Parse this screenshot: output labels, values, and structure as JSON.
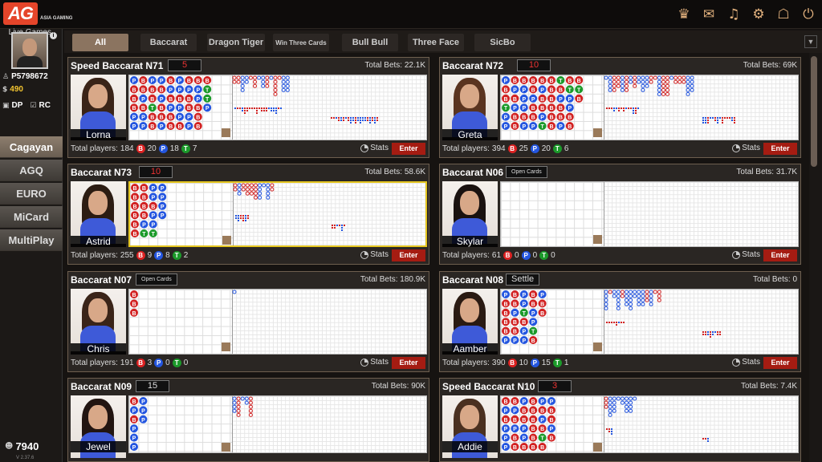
{
  "app": {
    "logo": "AG",
    "logo_sub": "ASIA GAMING"
  },
  "top_icons": [
    "vip-icon",
    "chat-icon",
    "music-icon",
    "settings-icon",
    "message-icon",
    "power-icon"
  ],
  "user": {
    "id": "P5798672",
    "credit": "490",
    "dp": "DP",
    "rc": "RC",
    "live_games": "Live Games"
  },
  "menu": [
    {
      "label": "Cagayan",
      "active": true
    },
    {
      "label": "AGQ"
    },
    {
      "label": "EURO"
    },
    {
      "label": "MiCard"
    },
    {
      "label": "MultiPlay"
    }
  ],
  "online_count": "7940",
  "version": "V 2.37.6",
  "tabs": [
    {
      "label": "All",
      "active": true
    },
    {
      "label": "Baccarat"
    },
    {
      "label": "Dragon Tiger"
    },
    {
      "label": "Win Three Cards"
    },
    {
      "label": "Bull Bull"
    },
    {
      "label": "Three Face"
    },
    {
      "label": "SicBo"
    }
  ],
  "labels": {
    "total_bets": "Total Bets:",
    "total_players": "Total players:",
    "stats": "Stats",
    "enter": "Enter"
  },
  "tables": [
    {
      "name": "Speed Baccarat N71",
      "countdown": "5",
      "total_bets": "22.1K",
      "dealer": "Lorna",
      "players": "184",
      "b": "20",
      "p": "18",
      "t": "7"
    },
    {
      "name": "Baccarat N72",
      "countdown": "10",
      "total_bets": "69K",
      "dealer": "Greta",
      "players": "394",
      "b": "25",
      "p": "20",
      "t": "6"
    },
    {
      "name": "Baccarat N73",
      "countdown": "10",
      "total_bets": "58.6K",
      "dealer": "Astrid",
      "players": "255",
      "b": "9",
      "p": "8",
      "t": "2"
    },
    {
      "name": "Baccarat N06",
      "status": "Open Cards",
      "total_bets": "31.7K",
      "dealer": "Skylar",
      "players": "61",
      "b": "0",
      "p": "0",
      "t": "0"
    },
    {
      "name": "Baccarat N07",
      "status": "Open Cards",
      "total_bets": "180.9K",
      "dealer": "Chris",
      "players": "191",
      "b": "3",
      "p": "0",
      "t": "0"
    },
    {
      "name": "Baccarat N08",
      "status": "Settle",
      "total_bets": "0",
      "dealer": "Aamber",
      "players": "390",
      "b": "10",
      "p": "15",
      "t": "1"
    },
    {
      "name": "Baccarat N09",
      "countdown": "15",
      "total_bets": "90K",
      "dealer": "Jewel"
    },
    {
      "name": "Speed Baccarat N10",
      "countdown": "3",
      "total_bets": "7.4K",
      "dealer": "Addie"
    }
  ],
  "colors": {
    "banker": "#d22222",
    "player": "#2456e0",
    "tie": "#1b9a2a",
    "enter": "#a51c12",
    "accent": "#e3b27e"
  }
}
